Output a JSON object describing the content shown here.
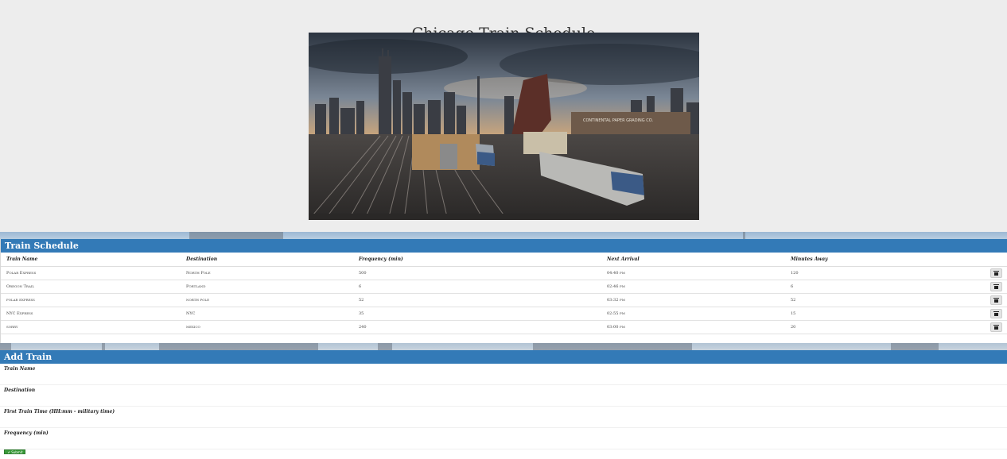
{
  "page": {
    "title": "Chicago Train Schedule"
  },
  "hero": {
    "alt": "Chicago skyline with rail yard and trains",
    "sign_text": "CONTINENTAL PAPER GRADING CO."
  },
  "schedule": {
    "heading": "Train Schedule",
    "columns": [
      "Train Name",
      "Destination",
      "Frequency (min)",
      "Next Arrival",
      "Minutes Away"
    ],
    "rows": [
      [
        "Polar Express",
        "North Pole",
        "500",
        "04:40 pm",
        "120"
      ],
      [
        "Oregon Trail",
        "Portland",
        "6",
        "02:46 pm",
        "6"
      ],
      [
        "polar express",
        "north pole",
        "52",
        "03:32 pm",
        "52"
      ],
      [
        "NYC Express",
        "NYC",
        "35",
        "02:55 pm",
        "15"
      ],
      [
        "sorry",
        "mexico",
        "240",
        "03:00 pm",
        "20"
      ]
    ],
    "delete_icon": "trash-icon"
  },
  "add_train": {
    "heading": "Add Train",
    "fields": [
      {
        "label": "Train Name",
        "placeholder": ""
      },
      {
        "label": "Destination",
        "placeholder": ""
      },
      {
        "label": "First Train Time (HH:mm - military time)",
        "placeholder": ""
      },
      {
        "label": "Frequency (min)",
        "placeholder": ""
      }
    ],
    "submit_label": "✔ Submit"
  },
  "colors": {
    "heading_blue": "#337ab7",
    "page_bg": "#ededed",
    "submit_green": "#3a9a3a"
  }
}
